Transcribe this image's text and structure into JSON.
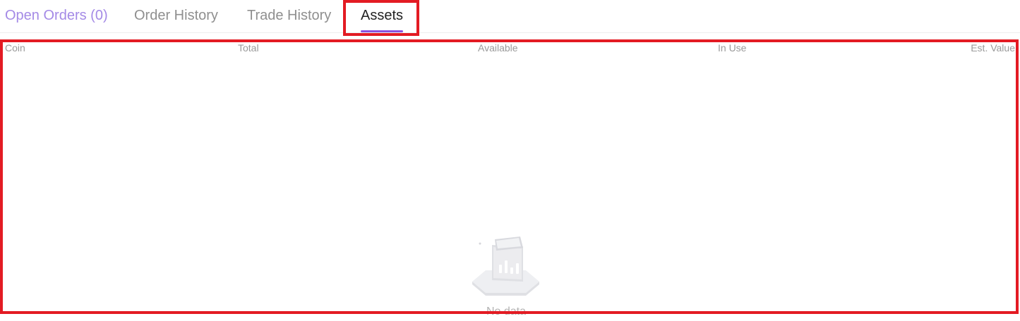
{
  "tabs": [
    {
      "label": "Open Orders (0)"
    },
    {
      "label": "Order History"
    },
    {
      "label": "Trade History"
    },
    {
      "label": "Assets"
    }
  ],
  "active_tab": "Assets",
  "table": {
    "columns": [
      "Coin",
      "Total",
      "Available",
      "In Use",
      "Est. Value"
    ],
    "rows": []
  },
  "empty_state": {
    "icon": "empty-data-icon",
    "text": "No data"
  },
  "colors": {
    "accent": "#8a52e0",
    "open_orders_tab": "#a48ae6",
    "highlight": "#e31b23"
  }
}
